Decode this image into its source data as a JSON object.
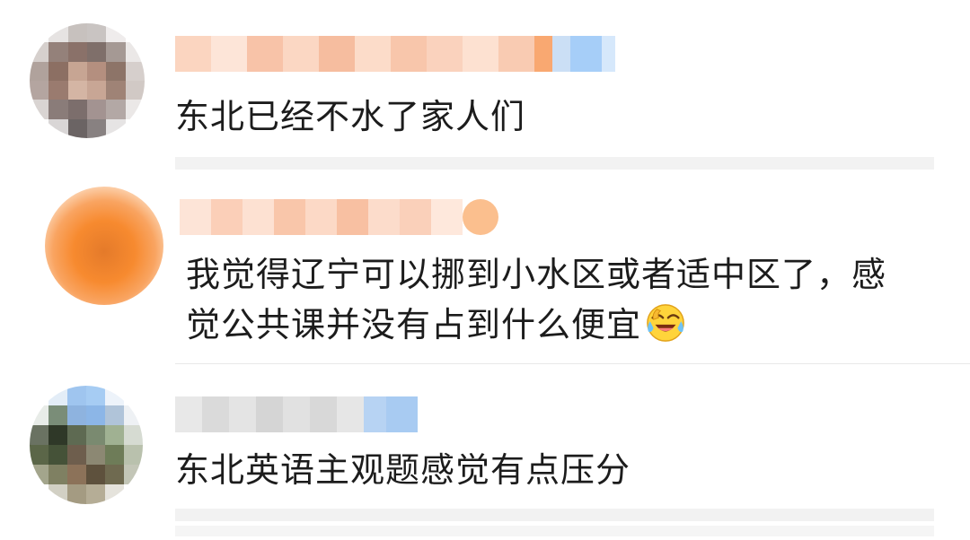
{
  "comments": [
    {
      "text": "东北已经不水了家人们"
    },
    {
      "text_line1": "我觉得辽宁可以挪到小水区或者适中区了，感",
      "text_line2": "觉公共课并没有占到什么便宜",
      "emoji": "laughing-crying-emoji"
    },
    {
      "text": "东北英语主观题感觉有点压分"
    }
  ],
  "colors": {
    "text": "#1c1c1c",
    "divider": "#e8e8e8",
    "blur_name_orange": "#f9c9ad",
    "blur_name_blue": "#a9cdf5",
    "avatar_orange": "#f7892e"
  }
}
